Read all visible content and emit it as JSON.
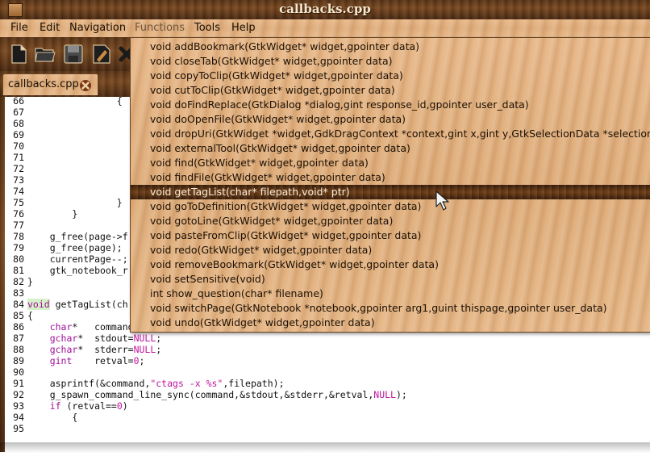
{
  "window": {
    "title": "callbacks.cpp"
  },
  "menu": [
    "File",
    "Edit",
    "Navigation",
    "Functions",
    "Tools",
    "Help"
  ],
  "toolbar": {
    "buttons": [
      "new-file-icon",
      "open-folder-icon",
      "save-icon",
      "edit-icon",
      "close-icon"
    ]
  },
  "tab": {
    "label": "callbacks.cpp"
  },
  "editor": {
    "lines": [
      {
        "n": "66",
        "code": "                {"
      },
      {
        "n": "67",
        "code": ""
      },
      {
        "n": "68",
        "code": ""
      },
      {
        "n": "69",
        "code": ""
      },
      {
        "n": "70",
        "code": ""
      },
      {
        "n": "71",
        "code": ""
      },
      {
        "n": "72",
        "code": ""
      },
      {
        "n": "73",
        "code": ""
      },
      {
        "n": "74",
        "code": ""
      },
      {
        "n": "75",
        "code": "                }"
      },
      {
        "n": "76",
        "code": "        }"
      },
      {
        "n": "77",
        "code": ""
      },
      {
        "n": "78",
        "code": "    g_free(page->f"
      },
      {
        "n": "79",
        "code": "    g_free(page);"
      },
      {
        "n": "80",
        "code": "    currentPage--;"
      },
      {
        "n": "81",
        "code": "    gtk_notebook_r"
      },
      {
        "n": "82",
        "code": "}"
      },
      {
        "n": "83",
        "code": ""
      },
      {
        "n": "84",
        "code": "void getTagList(ch"
      },
      {
        "n": "85",
        "code": "{"
      },
      {
        "n": "86",
        "code": "    char*   command"
      },
      {
        "n": "87",
        "code": "    gchar*  stdout=NULL;"
      },
      {
        "n": "88",
        "code": "    gchar*  stderr=NULL;"
      },
      {
        "n": "89",
        "code": "    gint    retval=0;"
      },
      {
        "n": "90",
        "code": ""
      },
      {
        "n": "91",
        "code": "    asprintf(&command,\"ctags -x %s\",filepath);"
      },
      {
        "n": "92",
        "code": "    g_spawn_command_line_sync(command,&stdout,&stderr,&retval,NULL);"
      },
      {
        "n": "93",
        "code": "    if (retval==0)"
      },
      {
        "n": "94",
        "code": "        {"
      },
      {
        "n": "95",
        "code": ""
      }
    ]
  },
  "functions_popup": {
    "items": [
      "void addBookmark(GtkWidget* widget,gpointer data)",
      "void closeTab(GtkWidget* widget,gpointer data)",
      "void copyToClip(GtkWidget* widget,gpointer data)",
      "void cutToClip(GtkWidget* widget,gpointer data)",
      "void doFindReplace(GtkDialog *dialog,gint response_id,gpointer user_data)",
      "void doOpenFile(GtkWidget* widget,gpointer data)",
      "void dropUri(GtkWidget *widget,GdkDragContext *context,gint x,gint y,GtkSelectionData *selection",
      "void externalTool(GtkWidget* widget,gpointer data)",
      "void find(GtkWidget* widget,gpointer data)",
      "void findFile(GtkWidget* widget,gpointer data)",
      "void getTagList(char* filepath,void* ptr)",
      "void goToDefinition(GtkWidget* widget,gpointer data)",
      "void gotoLine(GtkWidget* widget,gpointer data)",
      "void pasteFromClip(GtkWidget* widget,gpointer data)",
      "void redo(GtkWidget* widget,gpointer data)",
      "void removeBookmark(GtkWidget* widget,gpointer data)",
      "void setSensitive(void)",
      "int show_question(char* filename)",
      "void switchPage(GtkNotebook *notebook,gpointer arg1,guint thispage,gpointer user_data)",
      "void undo(GtkWidget* widget,gpointer data)"
    ],
    "selected_index": 10
  },
  "colors": {
    "wood_dark": "#6a3f1c",
    "wood_light": "#e2b283",
    "keyword": "#a0109a",
    "highlight_line": "#d6f0c8"
  }
}
